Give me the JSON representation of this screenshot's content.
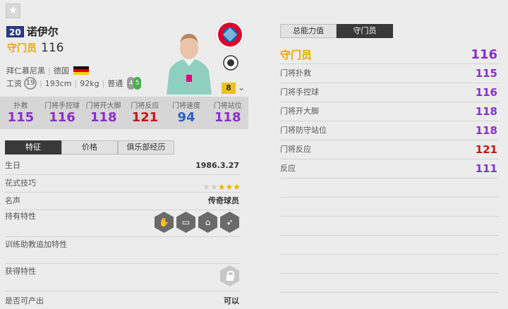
{
  "player": {
    "ovr": "20",
    "name": "诺伊尔",
    "position": "守门员",
    "position_ovr": "116",
    "club": "拜仁慕尼黑",
    "nation": "德国",
    "wage_label": "工资",
    "wage": "19",
    "height": "193cm",
    "weight": "92kg",
    "body_type": "普通",
    "weak_foot": "4",
    "strong_foot": "5",
    "level": "8",
    "flag_colors": [
      "#000000",
      "#dd0000",
      "#ffce00"
    ],
    "club_logo_icon": "fc-bayern-logo",
    "league_logo_icon": "dfb-logo",
    "favorite_icon": "star-icon"
  },
  "stats": [
    {
      "label": "扑救",
      "value": "115",
      "color": "#8b2fc9"
    },
    {
      "label": "门将手控球",
      "value": "116",
      "color": "#8b2fc9"
    },
    {
      "label": "门将开大脚",
      "value": "118",
      "color": "#8b2fc9"
    },
    {
      "label": "门将反应",
      "value": "121",
      "color": "#c4161c"
    },
    {
      "label": "门将速度",
      "value": "94",
      "color": "#2b5fc4"
    },
    {
      "label": "门将站位",
      "value": "118",
      "color": "#8b2fc9"
    }
  ],
  "left_tabs": [
    "特征",
    "价格",
    "俱乐部经历"
  ],
  "details": {
    "birthday_label": "生日",
    "birthday": "1986.3.27",
    "skill_moves_label": "花式技巧",
    "skill_moves": 3,
    "skill_moves_max": 5,
    "reputation_label": "名声",
    "reputation": "传奇球员",
    "traits_label": "持有特性",
    "traits_icons": [
      "gk-glove-icon",
      "gk-long-throw-icon",
      "gk-one-on-one-icon",
      "gk-rush-out-icon"
    ],
    "training_traits_label": "训练助教追加特性",
    "obtained_traits_label": "获得特性",
    "obtained_traits_icon": "lock-icon",
    "producible_label": "是否可产出",
    "producible": "可以"
  },
  "right_tabs": [
    "总能力值",
    "守门员"
  ],
  "right": {
    "main_label": "守门员",
    "main_value": "116",
    "rows": [
      {
        "label": "门将扑救",
        "value": "115",
        "color": "#8b2fc9"
      },
      {
        "label": "门将手控球",
        "value": "116",
        "color": "#8b2fc9"
      },
      {
        "label": "门将开大脚",
        "value": "118",
        "color": "#8b2fc9"
      },
      {
        "label": "门将防守站位",
        "value": "118",
        "color": "#8b2fc9"
      },
      {
        "label": "门将反应",
        "value": "121",
        "color": "#c4161c"
      },
      {
        "label": "反应",
        "value": "111",
        "color": "#8b2fc9"
      }
    ]
  }
}
